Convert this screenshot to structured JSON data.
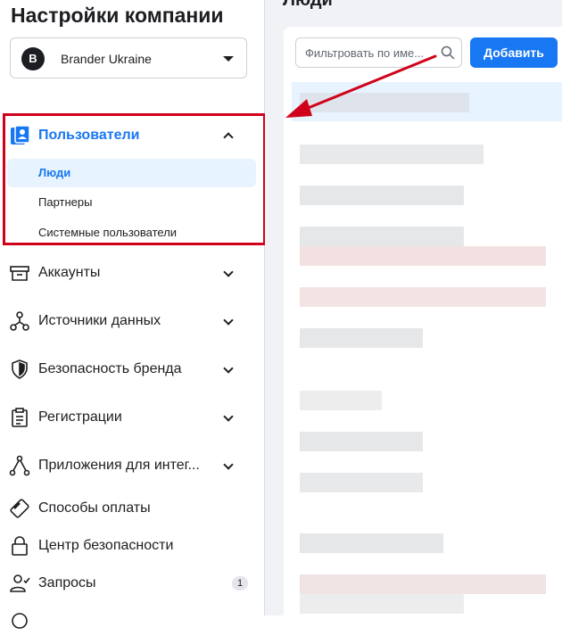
{
  "sidebar": {
    "title": "Настройки компании",
    "account": {
      "avatar_letter": "B",
      "name": "Brander Ukraine"
    },
    "users_section": {
      "label": "Пользователи",
      "sub_items": [
        {
          "label": "Люди",
          "active": true
        },
        {
          "label": "Партнеры",
          "active": false
        },
        {
          "label": "Системные пользователи",
          "active": false
        }
      ]
    },
    "items": [
      {
        "label": "Аккаунты",
        "icon": "archive-box-icon",
        "expandable": true
      },
      {
        "label": "Источники данных",
        "icon": "data-sources-icon",
        "expandable": true
      },
      {
        "label": "Безопасность бренда",
        "icon": "shield-icon",
        "expandable": true
      },
      {
        "label": "Регистрации",
        "icon": "clipboard-icon",
        "expandable": true
      },
      {
        "label": "Приложения для интег...",
        "icon": "integrations-icon",
        "expandable": true
      },
      {
        "label": "Способы оплаты",
        "icon": "credit-card-icon",
        "expandable": false
      },
      {
        "label": "Центр безопасности",
        "icon": "lock-icon",
        "expandable": false
      },
      {
        "label": "Запросы",
        "icon": "user-check-icon",
        "expandable": false,
        "badge": "1"
      }
    ]
  },
  "main": {
    "heading": "Люди",
    "search": {
      "placeholder": "Фильтровать по име...",
      "value": ""
    },
    "add_button": "Добавить"
  },
  "colors": {
    "accent": "#1877f2",
    "highlight": "#d0021b",
    "active_bg": "#e7f3ff"
  }
}
